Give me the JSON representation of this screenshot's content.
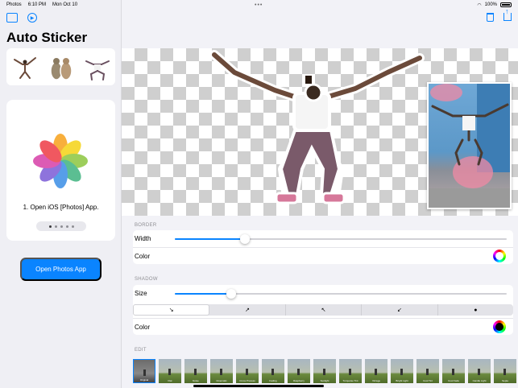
{
  "status_bar": {
    "app": "Photos",
    "time": "6:10 PM",
    "date": "Mon Oct 10",
    "battery": "100%"
  },
  "sidebar": {
    "title": "Auto Sticker",
    "step_text": "1. Open iOS [Photos] App.",
    "open_button": "Open Photos App",
    "pager": {
      "count": 5,
      "active_index": 0
    }
  },
  "editor": {
    "border": {
      "section": "BORDER",
      "width_label": "Width",
      "width_value": 0.21,
      "color_label": "Color",
      "color": "#ffffff"
    },
    "shadow": {
      "section": "SHADOW",
      "size_label": "Size",
      "size_value": 0.17,
      "directions": [
        "↘",
        "↗",
        "↖",
        "↙",
        "●"
      ],
      "selected_direction": 0,
      "color_label": "Color",
      "color": "#000000"
    },
    "edit": {
      "section": "EDIT",
      "filters": [
        "Original",
        "Flat",
        "Noise",
        "Cinematic",
        "Cross Process",
        "Fading",
        "Raspberry",
        "Sunlight",
        "Turquoise Tint",
        "Vintage",
        "Bright Light",
        "Cool Tint",
        "Cool Fade",
        "Candle Light",
        "Sepia"
      ]
    }
  },
  "colors": {
    "accent": "#0a84ff"
  }
}
